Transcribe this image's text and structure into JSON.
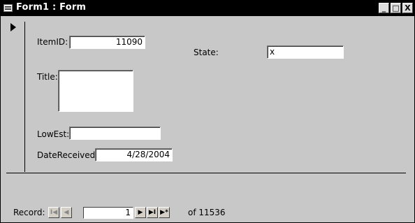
{
  "window": {
    "title": "Form1 : Form",
    "buttons": {
      "minimize": "_",
      "restore": "□",
      "close": "X"
    }
  },
  "record_selector_icon": "current-record-arrow",
  "form": {
    "item_id": {
      "label": "ItemID:",
      "value": "11090"
    },
    "state": {
      "label": "State:",
      "value": "x"
    },
    "title": {
      "label": "Title:",
      "value": ""
    },
    "low_est": {
      "label": "LowEst:",
      "value": ""
    },
    "date_received": {
      "label": "DateReceived:",
      "value": "4/28/2004"
    }
  },
  "navigator": {
    "label": "Record:",
    "first": "I◀",
    "prev": "◀",
    "current": "1",
    "next": "▶",
    "last": "▶I",
    "new": "▶*",
    "of_text": "of 11536"
  }
}
